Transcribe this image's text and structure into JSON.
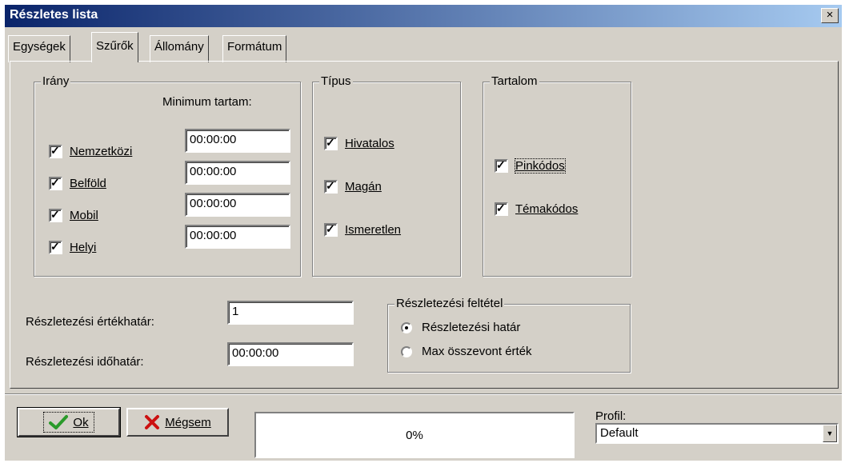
{
  "window": {
    "title": "Részletes lista",
    "close_label": "×"
  },
  "tabs": [
    {
      "label": "Egységek",
      "active": false
    },
    {
      "label": "Szűrők",
      "active": true
    },
    {
      "label": "Állomány",
      "active": false
    },
    {
      "label": "Formátum",
      "active": false
    }
  ],
  "irany": {
    "label": "Irány",
    "min_header": "Minimum tartam:",
    "items": [
      {
        "label": "Nemzetközi",
        "checked": true,
        "value": "00:00:00"
      },
      {
        "label": "Belföld",
        "checked": true,
        "value": "00:00:00"
      },
      {
        "label": "Mobil",
        "checked": true,
        "value": "00:00:00"
      },
      {
        "label": "Helyi",
        "checked": true,
        "value": "00:00:00"
      }
    ]
  },
  "tipus": {
    "label": "Típus",
    "items": [
      {
        "label": "Hivatalos",
        "checked": true
      },
      {
        "label": "Magán",
        "checked": true
      },
      {
        "label": "Ismeretlen",
        "checked": true
      }
    ]
  },
  "tartalom": {
    "label": "Tartalom",
    "items": [
      {
        "label": "Pinkódos",
        "checked": true
      },
      {
        "label": "Témakódos",
        "checked": true
      }
    ]
  },
  "ertekhatar": {
    "label": "Részletezési értékhatár:",
    "value": "1"
  },
  "idohatar": {
    "label": "Részletezési időhatár:",
    "value": "00:00:00"
  },
  "feltetel": {
    "label": "Részletezési feltétel",
    "options": [
      {
        "label": "Részletezési határ",
        "selected": true
      },
      {
        "label": "Max összevont érték",
        "selected": false
      }
    ]
  },
  "footer": {
    "ok_label": "Ok",
    "cancel_label": "Mégsem",
    "progress_text": "0%",
    "progress_value": 0,
    "profile_label": "Profil:",
    "profile_value": "Default"
  },
  "colors": {
    "title_start": "#0a246a",
    "title_end": "#a6caf0",
    "face": "#d4d0c8",
    "ok_check": "#2a9a2a",
    "cancel_x": "#cc1111"
  },
  "icons": {
    "ok": "checkmark-icon",
    "cancel": "x-icon",
    "dropdown": "chevron-down-icon"
  }
}
